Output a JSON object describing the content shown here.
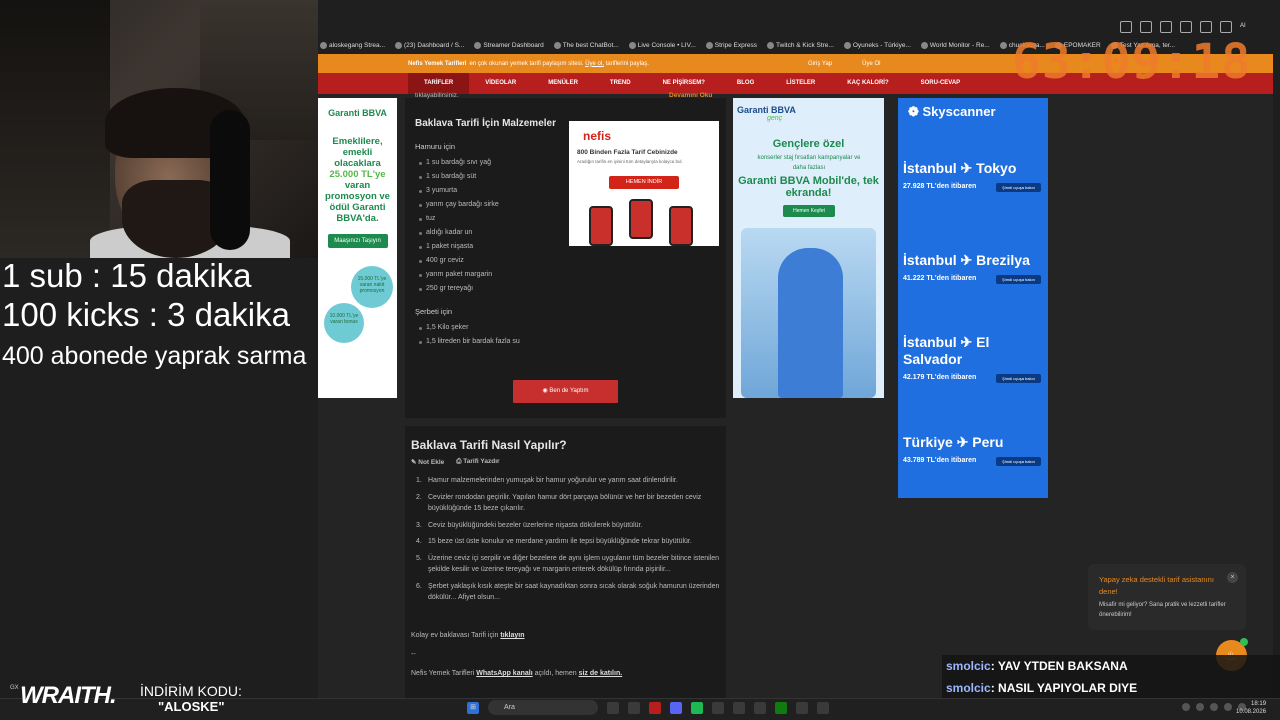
{
  "stream": {
    "overlay_lines": [
      "1 sub : 15 dakika",
      "100 kicks : 3 dakika",
      "400 abonede yaprak sarma"
    ],
    "timer": "63:09:18",
    "sponsor_brand": "WRAITH.",
    "sponsor_code_label": "İNDİRİM KODU:",
    "sponsor_code": "\"ALOSKE\""
  },
  "browser": {
    "bookmarks": [
      "aloskegang Strea...",
      "(23) Dashboard / S...",
      "Streamer Dashboard",
      "The best ChatBot...",
      "Live Console • LIV...",
      "Stripe Express",
      "Twitch & Kick Stre...",
      "Oyuneks - Türkiye...",
      "World Monitor - Re...",
      "chuckscoa...",
      "EPOMAKER",
      "Test Yaz Ama, ter..."
    ],
    "ext_labels": [
      "AI"
    ]
  },
  "site": {
    "topbar_brand": "Nefis Yemek Tarifleri",
    "topbar_text": "en çok okunan yemek tarifi paylaşım sitesi.",
    "topbar_link": "Üye ol,",
    "topbar_tail": "tariflerini paylaş.",
    "login": "Giriş Yap",
    "signup": "Üye Ol",
    "nav": [
      "TARİFLER",
      "VİDEOLAR",
      "MENÜLER",
      "TREND",
      "NE PİŞİRSEM?",
      "BLOG",
      "LİSTELER",
      "KAÇ KALORİ?",
      "SORU-CEVAP"
    ],
    "recipe_note": "tıklayabilirsiniz.",
    "read_more": "Devamını Oku",
    "ingredients_title": "Baklava Tarifi İçin Malzemeler",
    "dough_title": "Hamuru için",
    "dough": [
      "1 su bardağı sıvı yağ",
      "1 su bardağı süt",
      "3 yumurta",
      "yarım çay bardağı sirke",
      "tuz",
      "aldığı kadar un",
      "1 paket nişasta",
      "400 gr ceviz",
      "yarım paket margarin",
      "250 gr tereyağı"
    ],
    "syrup_title": "Şerbeti için",
    "syrup": [
      "1,5 Kilo şeker",
      "1,5 litreden bir bardak fazla su"
    ],
    "made_button": "Ben de Yaptım",
    "steps_title": "Baklava Tarifi Nasıl Yapılır?",
    "note_add": "Not Ekle",
    "print": "Tarifi Yazdır",
    "steps": [
      "Hamur malzemelerinden yumuşak bir hamur yoğurulur ve yarım saat dinlendirilir.",
      "Cevizler rondodan geçirilir. Yapılan hamur dört parçaya bölünür ve her bir bezeden ceviz büyüklüğünde 15 beze çıkarılır.",
      "Ceviz büyüklüğündeki bezeler üzerlerine nişasta dökülerek büyütülür.",
      "15 beze üst üste konulur ve merdane yardımı ile tepsi büyüklüğünde tekrar büyütülür.",
      "Üzerine ceviz içi serpilir ve diğer bezelere de aynı işlem uygulanır tüm bezeler bitince istenilen şekilde kesilir ve üzerine tereyağı ve margarin eriterek dökülüp fırında pişirilir...",
      "Şerbet yaklaşık kısık ateşte bir saat kaynadıktan sonra sıcak olarak soğuk hamurun üzerinden dökülür... Afiyet olsun..."
    ],
    "extra1_pre": "Kolay ev baklavası Tarifi için",
    "extra1_link": "tıklayın",
    "extra2": "--",
    "extra3_pre": "Nefis Yemek Tarifleri",
    "extra3_link1": "WhatsApp kanalı",
    "extra3_mid": "açıldı, hemen",
    "extra3_link2": "siz de katılın."
  },
  "ads": {
    "garanti_logo": "Garanti BBVA",
    "garanti_text_a": "Emeklilere, emekli olacaklara",
    "garanti_amount": "25.000 TL'ye",
    "garanti_text_b": "varan promosyon ve ödül Garanti BBVA'da.",
    "garanti_btn": "Maaşınızı Taşıyın",
    "garanti_c1": "15.000 TL'ye varan nakit promosyon",
    "garanti_c2": "10.000 TL'ye varan bonus",
    "nefis_logo": "nefis",
    "nefis_head": "800 Binden Fazla Tarif Cebinizde",
    "nefis_sub": "Aradığın tarifin en iyisini tüm detaylarıyla kolayca bul.",
    "nefis_btn": "HEMEN İNDİR",
    "bbva_logo": "Garanti BBVA",
    "bbva_sub": "genç",
    "bbva_t1": "Gençlere özel",
    "bbva_tags": "konserler staj fırsatları kampanyalar ve daha fazlası",
    "bbva_t2": "Garanti BBVA Mobil'de, tek ekranda!",
    "bbva_btn": "Hemen Keşfet",
    "sky_logo": "Skyscanner",
    "routes": [
      {
        "route": "İstanbul ✈ Tokyo",
        "price": "27.928 TL'den itibaren",
        "cta": "Şimdi uçuşa bakın"
      },
      {
        "route": "İstanbul ✈ Brezilya",
        "price": "41.222 TL'den itibaren",
        "cta": "Şimdi uçuşa bakın"
      },
      {
        "route": "İstanbul ✈ El Salvador",
        "price": "42.179 TL'den itibaren",
        "cta": "Şimdi uçuşa bakın"
      },
      {
        "route": "Türkiye ✈ Peru",
        "price": "43.789 TL'den itibaren",
        "cta": "Şimdi uçuşa bakın"
      }
    ]
  },
  "popup": {
    "title": "Yapay zeka destekli tarif asistanını dene!",
    "desc": "Misafir mi geliyor? Sana pratik ve lezzetli tarifler önerebilirim!"
  },
  "chat": [
    {
      "user": "smolcic",
      "msg": ": YAV YTDEN BAKSANA"
    },
    {
      "user": "smolcic",
      "msg": ": NASIL YAPIYOLAR DIYE"
    }
  ],
  "taskbar": {
    "search": "Ara",
    "time": "18:19",
    "date": "10.08.2026",
    "weather": "GX"
  }
}
